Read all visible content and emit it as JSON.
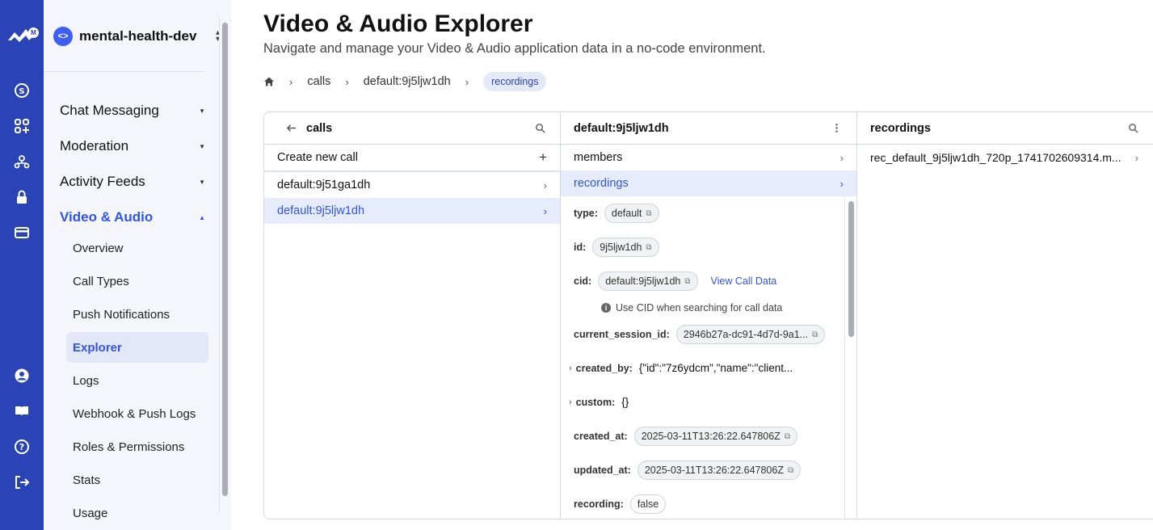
{
  "rail": {
    "logo_badge": "M",
    "top_icons": [
      "stream-logo-icon",
      "dollar-icon",
      "apps-icon",
      "team-icon",
      "lock-icon",
      "credit-card-icon"
    ],
    "bottom_icons": [
      "user-icon",
      "docs-icon",
      "help-icon",
      "logout-icon"
    ]
  },
  "sidebar": {
    "app_name": "mental-health-dev",
    "sections": [
      {
        "label": "Chat Messaging"
      },
      {
        "label": "Moderation"
      },
      {
        "label": "Activity Feeds"
      },
      {
        "label": "Video & Audio"
      }
    ],
    "sub_items": [
      {
        "label": "Overview"
      },
      {
        "label": "Call Types"
      },
      {
        "label": "Push Notifications"
      },
      {
        "label": "Explorer"
      },
      {
        "label": "Logs"
      },
      {
        "label": "Webhook & Push Logs"
      },
      {
        "label": "Roles & Permissions"
      },
      {
        "label": "Stats"
      },
      {
        "label": "Usage"
      }
    ]
  },
  "header": {
    "title": "Video & Audio Explorer",
    "subtitle": "Navigate and manage your Video & Audio application data in a no-code environment."
  },
  "breadcrumb": {
    "items": [
      "calls",
      "default:9j5ljw1dh",
      "recordings"
    ]
  },
  "calls_panel": {
    "title": "calls",
    "create_label": "Create new call",
    "rows": [
      "default:9j51ga1dh",
      "default:9j5ljw1dh"
    ]
  },
  "call_panel": {
    "title": "default:9j5ljw1dh",
    "nav": [
      "members",
      "recordings"
    ],
    "props": {
      "type_k": "type:",
      "type_v": "default",
      "id_k": "id:",
      "id_v": "9j5ljw1dh",
      "cid_k": "cid:",
      "cid_v": "default:9j5ljw1dh",
      "view_link": "View Call Data",
      "cid_note": "Use CID when searching for call data",
      "session_k": "current_session_id:",
      "session_v": "2946b27a-dc91-4d7d-9a1...",
      "created_by_k": "created_by:",
      "created_by_v": "{\"id\":\"7z6ydcm\",\"name\":\"client...",
      "custom_k": "custom:",
      "custom_v": "{}",
      "created_at_k": "created_at:",
      "created_at_v": "2025-03-11T13:26:22.647806Z",
      "updated_at_k": "updated_at:",
      "updated_at_v": "2025-03-11T13:26:22.647806Z",
      "recording_k": "recording:",
      "recording_v": "false"
    }
  },
  "recordings_panel": {
    "title": "recordings",
    "rows": [
      "rec_default_9j5ljw1dh_720p_1741702609314.m..."
    ]
  }
}
